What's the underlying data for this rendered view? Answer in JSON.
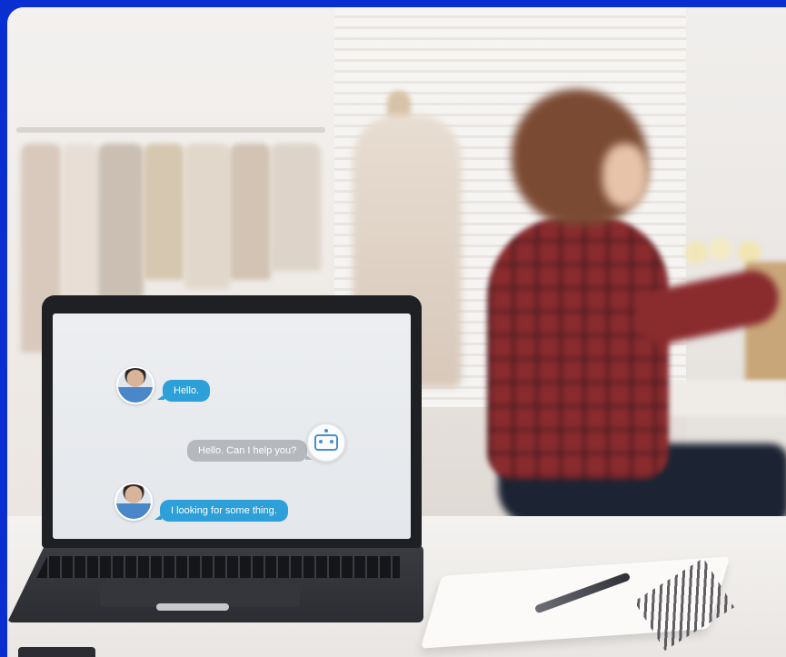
{
  "chat": {
    "messages": [
      {
        "sender": "user",
        "text": "Hello."
      },
      {
        "sender": "bot",
        "text": "Hello. Can I help you?"
      },
      {
        "sender": "user",
        "text": "I looking for some thing."
      }
    ]
  },
  "icons": {
    "user_avatar": "person-avatar-icon",
    "bot_avatar": "robot-icon"
  },
  "colors": {
    "border": "#0a2fd1",
    "user_bubble": "#2d9fd9",
    "bot_bubble": "#b5b8bd",
    "robot": "#4b8ed0"
  }
}
